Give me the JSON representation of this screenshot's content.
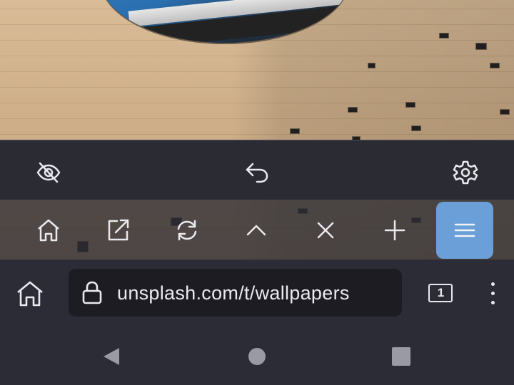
{
  "background": {
    "description_label": ""
  },
  "toolbar_top": {
    "icons": [
      "hide-eye-icon",
      "undo-icon",
      "gear-icon"
    ]
  },
  "quickbar": {
    "icons": [
      "home-icon",
      "open-external-icon",
      "refresh-icon",
      "chevron-up-icon",
      "close-icon",
      "plus-icon",
      "menu-icon"
    ],
    "active_color": "#6a9fd8"
  },
  "address_bar": {
    "url": "unsplash.com/t/wallpapers",
    "tab_count": "1"
  },
  "nav_bar": {
    "icons": [
      "back-triangle-icon",
      "home-circle-icon",
      "recents-square-icon"
    ]
  },
  "colors": {
    "bar_bg": "#2c2c36",
    "url_bg": "#1c1c22",
    "icon": "#e9e9ee",
    "nav_icon": "#9a9aa2"
  }
}
